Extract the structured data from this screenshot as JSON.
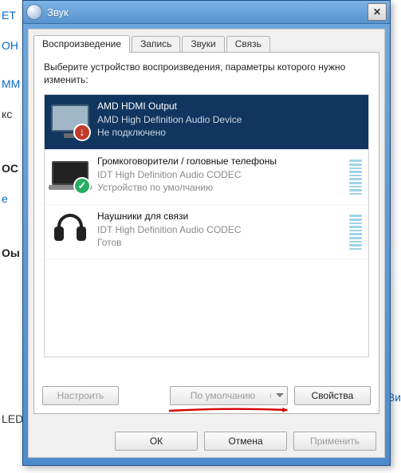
{
  "window": {
    "title": "Звук"
  },
  "tabs": [
    {
      "label": "Воспроизведение",
      "active": true
    },
    {
      "label": "Запись",
      "active": false
    },
    {
      "label": "Звуки",
      "active": false
    },
    {
      "label": "Связь",
      "active": false
    }
  ],
  "instruction": "Выберите устройство воспроизведения, параметры которого нужно изменить:",
  "devices": [
    {
      "name": "AMD HDMI Output",
      "driver": "AMD High Definition Audio Device",
      "status": "Не подключено",
      "selected": true,
      "icon": "monitor",
      "overlay": "x",
      "meter": false
    },
    {
      "name": "Громкоговорители / головные телефоны",
      "driver": "IDT High Definition Audio CODEC",
      "status": "Устройство по умолчанию",
      "selected": false,
      "icon": "laptop",
      "overlay": "check",
      "meter": true
    },
    {
      "name": "Наушники для связи",
      "driver": "IDT High Definition Audio CODEC",
      "status": "Готов",
      "selected": false,
      "icon": "headphones",
      "overlay": "",
      "meter": true
    }
  ],
  "panel_buttons": {
    "configure": "Настроить",
    "set_default": "По умолчанию",
    "properties": "Свойства"
  },
  "dialog_buttons": {
    "ok": "ОК",
    "cancel": "Отмена",
    "apply": "Применить"
  },
  "bg_snippets": [
    "ET",
    "ОН",
    "ММ",
    "кс",
    "OC",
    "е",
    "Оы",
    "LED"
  ],
  "bg_right": "Ви"
}
